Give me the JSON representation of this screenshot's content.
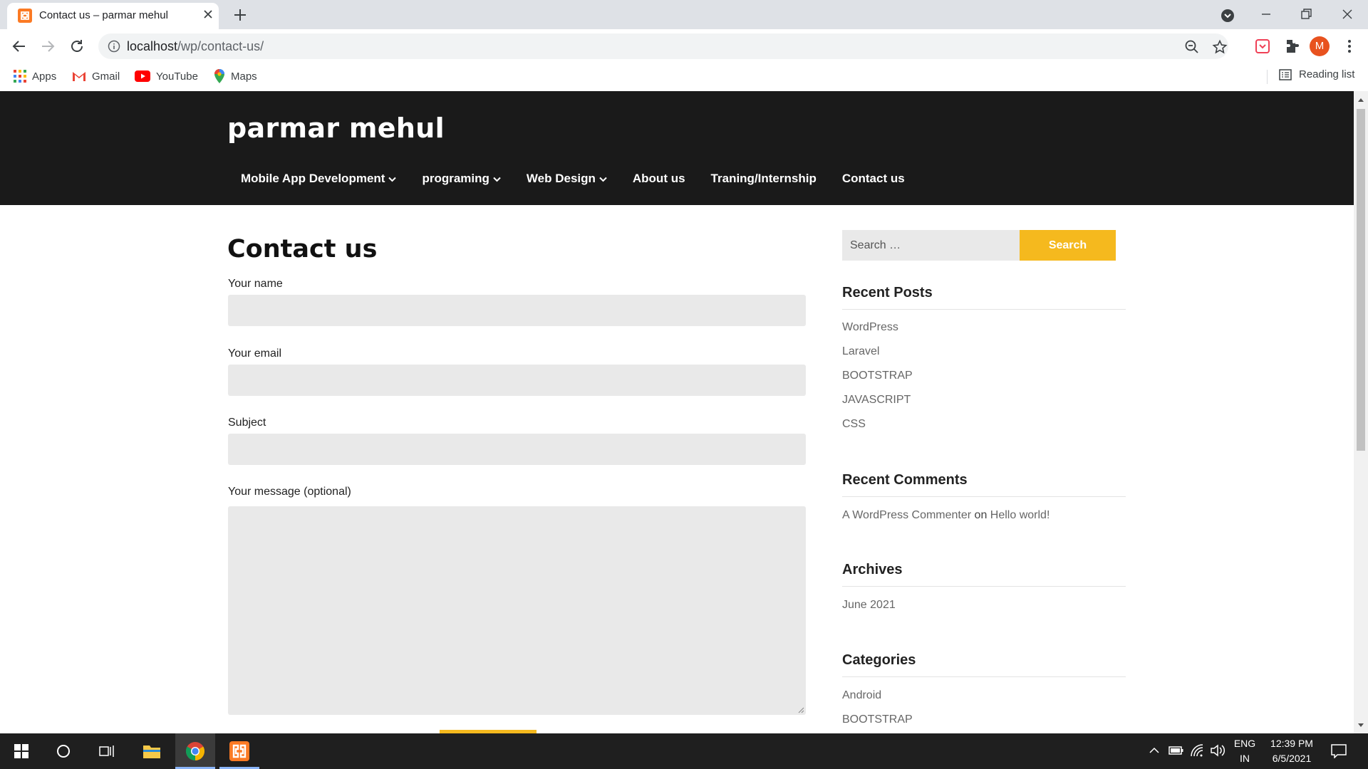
{
  "browser": {
    "tab_title": "Contact us – parmar mehul",
    "url_host": "localhost",
    "url_path": "/wp/contact-us/",
    "profile_initial": "M",
    "bookmarks": [
      "Apps",
      "Gmail",
      "YouTube",
      "Maps"
    ],
    "reading_list": "Reading list"
  },
  "site": {
    "title": "parmar mehul",
    "nav": [
      {
        "label": "Mobile App Development",
        "has_dropdown": true
      },
      {
        "label": "programing",
        "has_dropdown": true
      },
      {
        "label": "Web Design",
        "has_dropdown": true
      },
      {
        "label": "About us",
        "has_dropdown": false
      },
      {
        "label": "Traning/Internship",
        "has_dropdown": false
      },
      {
        "label": "Contact us",
        "has_dropdown": false
      }
    ]
  },
  "page": {
    "heading": "Contact us",
    "form": {
      "name_label": "Your name",
      "email_label": "Your email",
      "subject_label": "Subject",
      "message_label": "Your message (optional)"
    }
  },
  "sidebar": {
    "search_placeholder": "Search …",
    "search_button": "Search",
    "recent_posts_title": "Recent Posts",
    "recent_posts": [
      "WordPress",
      "Laravel",
      "BOOTSTRAP",
      "JAVASCRIPT",
      "CSS"
    ],
    "recent_comments_title": "Recent Comments",
    "comment": {
      "author": "A WordPress Commenter",
      "on": "on",
      "post": "Hello world!"
    },
    "archives_title": "Archives",
    "archives": [
      "June 2021"
    ],
    "categories_title": "Categories",
    "categories": [
      "Android",
      "BOOTSTRAP"
    ]
  },
  "taskbar": {
    "lang_top": "ENG",
    "lang_bottom": "IN",
    "time": "12:39 PM",
    "date": "6/5/2021"
  },
  "colors": {
    "header_bg": "#1a1a1a",
    "accent": "#f5b91e",
    "input_bg": "#e9e9e9"
  }
}
